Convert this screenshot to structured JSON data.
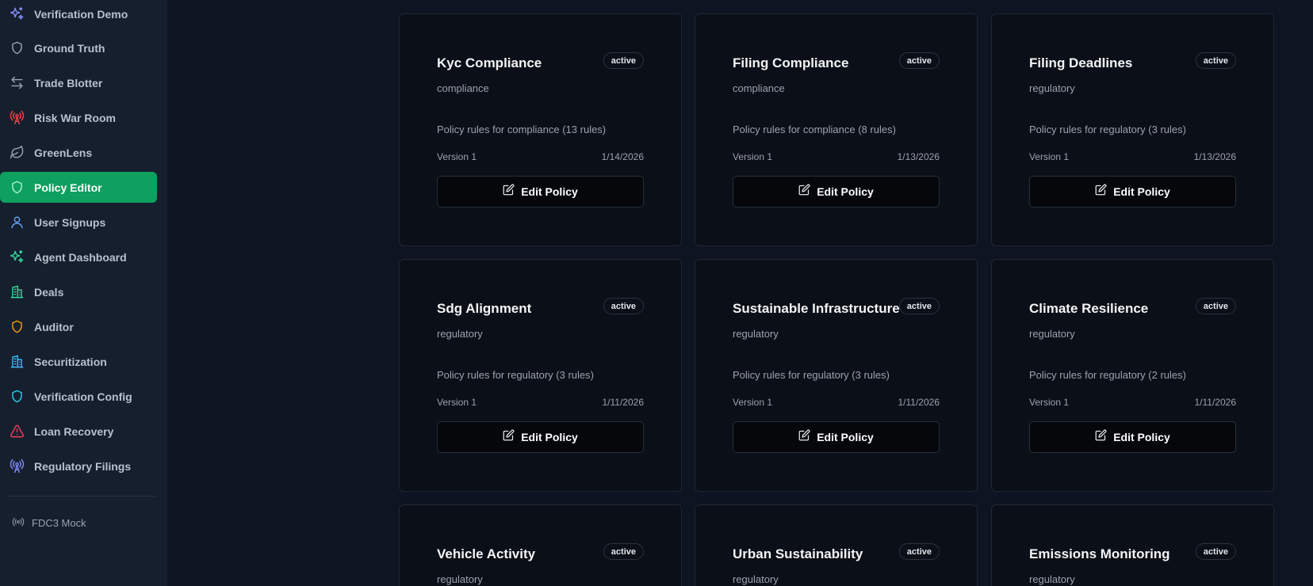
{
  "sidebar": {
    "items": [
      {
        "label": "Verification Demo",
        "icon": "sparkles-icon",
        "color": "#818cf8",
        "active": false
      },
      {
        "label": "Ground Truth",
        "icon": "shield-icon",
        "color": "#9ca3af",
        "active": false
      },
      {
        "label": "Trade Blotter",
        "icon": "arrows-left-right-icon",
        "color": "#9ca3af",
        "active": false
      },
      {
        "label": "Risk War Room",
        "icon": "radio-tower-icon",
        "color": "#ef4444",
        "active": false
      },
      {
        "label": "GreenLens",
        "icon": "leaf-icon",
        "color": "#9ca3af",
        "active": false
      },
      {
        "label": "Policy Editor",
        "icon": "shield-icon",
        "color": "#a7f3d0",
        "active": true
      },
      {
        "label": "User Signups",
        "icon": "user-icon",
        "color": "#60a5fa",
        "active": false
      },
      {
        "label": "Agent Dashboard",
        "icon": "sparkles-icon",
        "color": "#34d399",
        "active": false
      },
      {
        "label": "Deals",
        "icon": "building-icon",
        "color": "#34d399",
        "active": false
      },
      {
        "label": "Auditor",
        "icon": "shield-icon",
        "color": "#f59e0b",
        "active": false
      },
      {
        "label": "Securitization",
        "icon": "building-icon",
        "color": "#38bdf8",
        "active": false
      },
      {
        "label": "Verification Config",
        "icon": "shield-icon",
        "color": "#22d3ee",
        "active": false
      },
      {
        "label": "Loan Recovery",
        "icon": "alert-triangle-icon",
        "color": "#f43f5e",
        "active": false
      },
      {
        "label": "Regulatory Filings",
        "icon": "radio-tower-icon",
        "color": "#818cf8",
        "active": false
      }
    ],
    "footer": {
      "label": "FDC3 Mock",
      "icon": "broadcast-icon"
    }
  },
  "policies": [
    {
      "title": "Kyc Compliance",
      "status": "active",
      "category": "compliance",
      "description": "Policy rules for compliance (13 rules)",
      "version": "Version 1",
      "date": "1/14/2026",
      "button": "Edit Policy"
    },
    {
      "title": "Filing Compliance",
      "status": "active",
      "category": "compliance",
      "description": "Policy rules for compliance (8 rules)",
      "version": "Version 1",
      "date": "1/13/2026",
      "button": "Edit Policy"
    },
    {
      "title": "Filing Deadlines",
      "status": "active",
      "category": "regulatory",
      "description": "Policy rules for regulatory (3 rules)",
      "version": "Version 1",
      "date": "1/13/2026",
      "button": "Edit Policy"
    },
    {
      "title": "Sdg Alignment",
      "status": "active",
      "category": "regulatory",
      "description": "Policy rules for regulatory (3 rules)",
      "version": "Version 1",
      "date": "1/11/2026",
      "button": "Edit Policy"
    },
    {
      "title": "Sustainable Infrastructure",
      "status": "active",
      "category": "regulatory",
      "description": "Policy rules for regulatory (3 rules)",
      "version": "Version 1",
      "date": "1/11/2026",
      "button": "Edit Policy"
    },
    {
      "title": "Climate Resilience",
      "status": "active",
      "category": "regulatory",
      "description": "Policy rules for regulatory (2 rules)",
      "version": "Version 1",
      "date": "1/11/2026",
      "button": "Edit Policy"
    },
    {
      "title": "Vehicle Activity",
      "status": "active",
      "category": "regulatory",
      "description": "",
      "version": "",
      "date": "",
      "button": ""
    },
    {
      "title": "Urban Sustainability",
      "status": "active",
      "category": "regulatory",
      "description": "",
      "version": "",
      "date": "",
      "button": ""
    },
    {
      "title": "Emissions Monitoring",
      "status": "active",
      "category": "regulatory",
      "description": "",
      "version": "",
      "date": "",
      "button": ""
    }
  ]
}
